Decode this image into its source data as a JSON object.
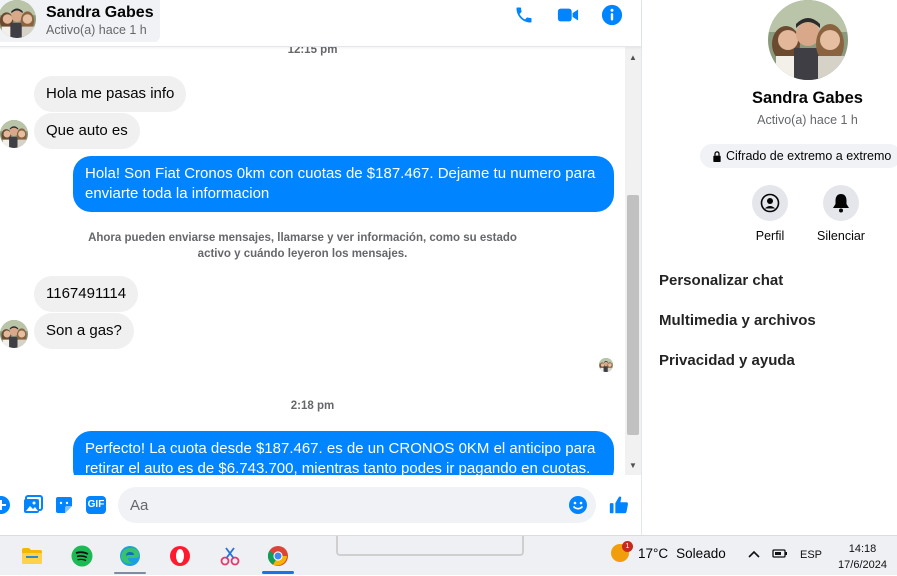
{
  "header": {
    "name": "Sandra Gabes",
    "status": "Activo(a) hace 1 h",
    "accent": "#0084ff"
  },
  "messages": {
    "ts1": "12:15 pm",
    "in1": "Hola me pasas info",
    "in2": "Que auto es",
    "out1": "Hola! Son Fiat Cronos 0km con cuotas de $187.467. Dejame tu numero para enviarte toda la informacion",
    "system": "Ahora pueden enviarse mensajes, llamarse y ver información, como su estado activo y cuándo leyeron los mensajes.",
    "in3": "1167491114",
    "in4": "Son a gas?",
    "ts2": "2:18 pm",
    "out2": "Perfecto! La cuota desde $187.467. es de un CRONOS 0KM el anticipo para retirar el auto es de $6.743.700, mientras tanto podes ir pagando en cuotas."
  },
  "composer": {
    "placeholder": "Aa",
    "gif_label": "GIF"
  },
  "info": {
    "name": "Sandra Gabes",
    "status": "Activo(a) hace 1 h",
    "e2e": "Cifrado de extremo a extremo",
    "profile_label": "Perfil",
    "mute_label": "Silenciar",
    "menu": [
      "Personalizar chat",
      "Multimedia y archivos",
      "Privacidad y ayuda"
    ]
  },
  "taskbar": {
    "weather_temp": "17°C",
    "weather_text": "Soleado",
    "weather_badge": "1",
    "lang": "ESP",
    "time": "14:18",
    "date": "17/6/2024"
  }
}
